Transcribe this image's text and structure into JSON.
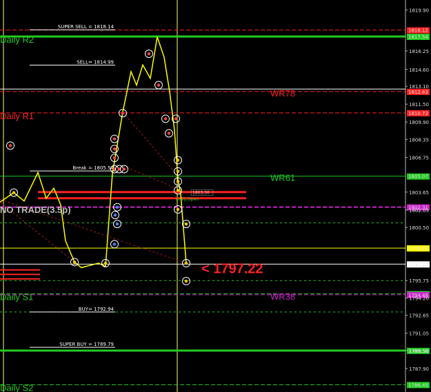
{
  "chart_data": {
    "type": "line",
    "x_labels": [],
    "y_axis": {
      "min": 1785.8,
      "max": 1820.8,
      "ticks": [
        "1819.90",
        "1816.25",
        "1814.60",
        "1813.10",
        "1811.50",
        "1809.90",
        "1808.35",
        "1806.75",
        "1803.65",
        "1802.05",
        "1800.50",
        "1795.75",
        "1794.20",
        "1792.65",
        "1791.05",
        "1789.50",
        "1787.90"
      ]
    },
    "current_price": "1797.22",
    "price_arrow": "<",
    "levels": [
      {
        "name": "SUPER SELL = 1818.14",
        "value": 1818.14,
        "color": "#ffffff",
        "style": "short"
      },
      {
        "name": "SELL= 1814.99",
        "value": 1814.99,
        "color": "#ffffff",
        "style": "short"
      },
      {
        "name": "Break = 1805.54",
        "value": 1805.54,
        "color": "#ffffff",
        "style": "short"
      },
      {
        "name": "BUY= 1792.94",
        "value": 1792.94,
        "color": "#ffffff",
        "style": "short"
      },
      {
        "name": "SUPER BUY = 1789.79",
        "value": 1789.79,
        "color": "#ffffff",
        "style": "short"
      }
    ],
    "lines": [
      {
        "label": "Daily R2",
        "value": 1817.54,
        "color": "#22cc22",
        "style": "solid",
        "width": 3,
        "tag": "1817.54",
        "tagColor": "#22cc22"
      },
      {
        "label": "",
        "value": 1818.12,
        "color": "#ff2222",
        "style": "dash",
        "width": 1,
        "tag": "1818.12",
        "tagColor": "#ff2222"
      },
      {
        "label": "WR78",
        "value": 1812.63,
        "color": "#ff2222",
        "style": "dash",
        "width": 1,
        "tag": "1812.63",
        "tagColor": "#ff2222"
      },
      {
        "label": "",
        "value": 1812.85,
        "color": "#ffffff",
        "style": "solid",
        "width": 1,
        "tag": "",
        "tagColor": ""
      },
      {
        "label": "Daily R1",
        "value": 1810.72,
        "color": "#ff2222",
        "style": "dash",
        "width": 1,
        "tag": "1810.72",
        "tagColor": "#ff2222"
      },
      {
        "label": "WR61",
        "value": 1805.07,
        "color": "#22cc22",
        "style": "solid",
        "width": 1,
        "tag": "1805.07",
        "tagColor": "#22cc22"
      },
      {
        "label": "",
        "value": 1802.31,
        "color": "#cc22cc",
        "style": "dash",
        "width": 2,
        "tag": "1802.31",
        "tagColor": "#cc22cc"
      },
      {
        "label": "",
        "value": 1800.9,
        "color": "#22cc22",
        "style": "dot",
        "width": 1,
        "tag": "",
        "tagColor": ""
      },
      {
        "label": "",
        "value": 1798.65,
        "color": "#ffff00",
        "style": "solid",
        "width": 1,
        "tag": "1798.65",
        "tagColor": "#ffff00"
      },
      {
        "label": "",
        "value": 1797.22,
        "color": "#ffffff",
        "style": "solid",
        "width": 1,
        "tag": "1797.22",
        "tagColor": "#ffffff"
      },
      {
        "label": "",
        "value": 1795.75,
        "color": "#22cc22",
        "style": "dot",
        "width": 1,
        "tag": "",
        "tagColor": ""
      },
      {
        "label": "Daily S1",
        "value": 1794.57,
        "color": "#22cc22",
        "style": "dash",
        "width": 1,
        "tag": "1794.57",
        "tagColor": "#22cc22"
      },
      {
        "label": "WR38",
        "value": 1794.48,
        "color": "#cc22cc",
        "style": "dash",
        "width": 1,
        "tag": "1794.48",
        "tagColor": "#cc22cc"
      },
      {
        "label": "",
        "value": 1792.94,
        "color": "#22cc22",
        "style": "dot",
        "width": 1,
        "tag": "",
        "tagColor": ""
      },
      {
        "label": "",
        "value": 1789.5,
        "color": "#22cc22",
        "style": "solid",
        "width": 3,
        "tag": "1789.50",
        "tagColor": "#22cc22"
      },
      {
        "label": "Daily S2",
        "value": 1786.45,
        "color": "#22cc22",
        "style": "dash",
        "width": 1,
        "tag": "1786.45",
        "tagColor": "#22cc22"
      }
    ],
    "price_series": [
      1802.75,
      1803.6,
      1802.85,
      1805.4,
      1803.1,
      1804.0,
      1802.5,
      1799.3,
      1797.4,
      1796.9,
      1797.15,
      1797.3,
      1797.0,
      1805.3,
      1810.8,
      1814.4,
      1813.2,
      1815.0,
      1813.8,
      1817.5,
      1815.7,
      1812.6,
      1809.2,
      1804.8,
      1803.5,
      1797.3
    ],
    "annotation_text": "NO TRADE(3.5p)",
    "daily_open_label": "Daily Open",
    "daily_open_price": "1803.30"
  }
}
